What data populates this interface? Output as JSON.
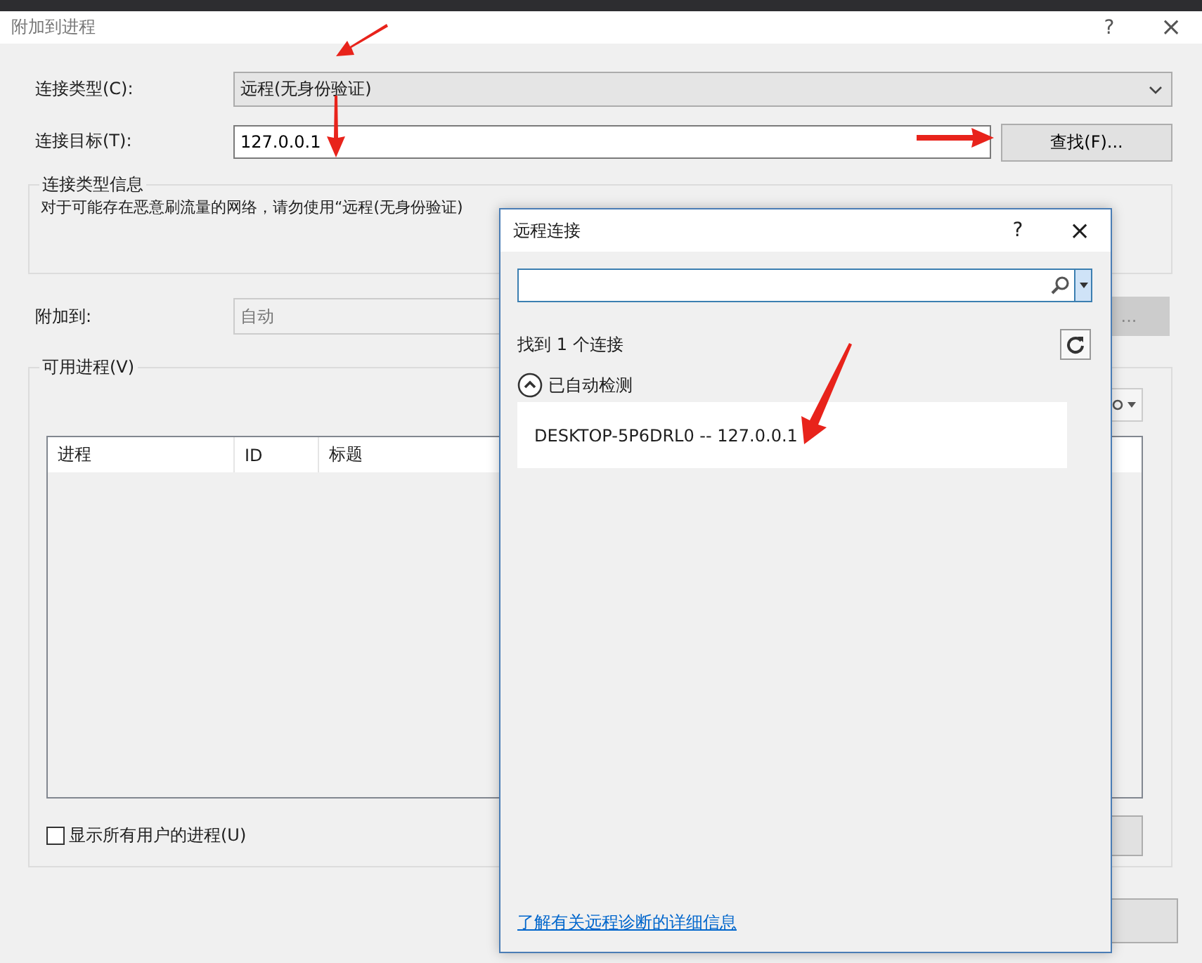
{
  "window": {
    "title": "附加到进程",
    "help": "?",
    "close": "×"
  },
  "connection_type": {
    "label": "连接类型(C):",
    "value": "远程(无身份验证)"
  },
  "connection_target": {
    "label": "连接目标(T):",
    "value": "127.0.0.1",
    "find_button": "查找(F)..."
  },
  "info_group": {
    "title": "连接类型信息",
    "text": "对于可能存在恶意刷流量的网络，请勿使用“远程(无身份验证)"
  },
  "attach_to": {
    "label": "附加到:",
    "placeholder": "自动",
    "disabled": true,
    "button": "..."
  },
  "processes": {
    "title": "可用进程(V)",
    "columns": [
      "进程",
      "ID",
      "标题"
    ],
    "show_all_users": {
      "label": "显示所有用户的进程(U)",
      "checked": false
    }
  },
  "remote_dialog": {
    "title": "远程连接",
    "help": "?",
    "close": "×",
    "found": "找到 1 个连接",
    "group": {
      "label": "已自动检测",
      "expanded": true,
      "items": [
        {
          "text": "DESKTOP-5P6DRL0 -- 127.0.0.1",
          "selected": false
        }
      ]
    },
    "link": "了解有关远程诊断的详细信息"
  }
}
